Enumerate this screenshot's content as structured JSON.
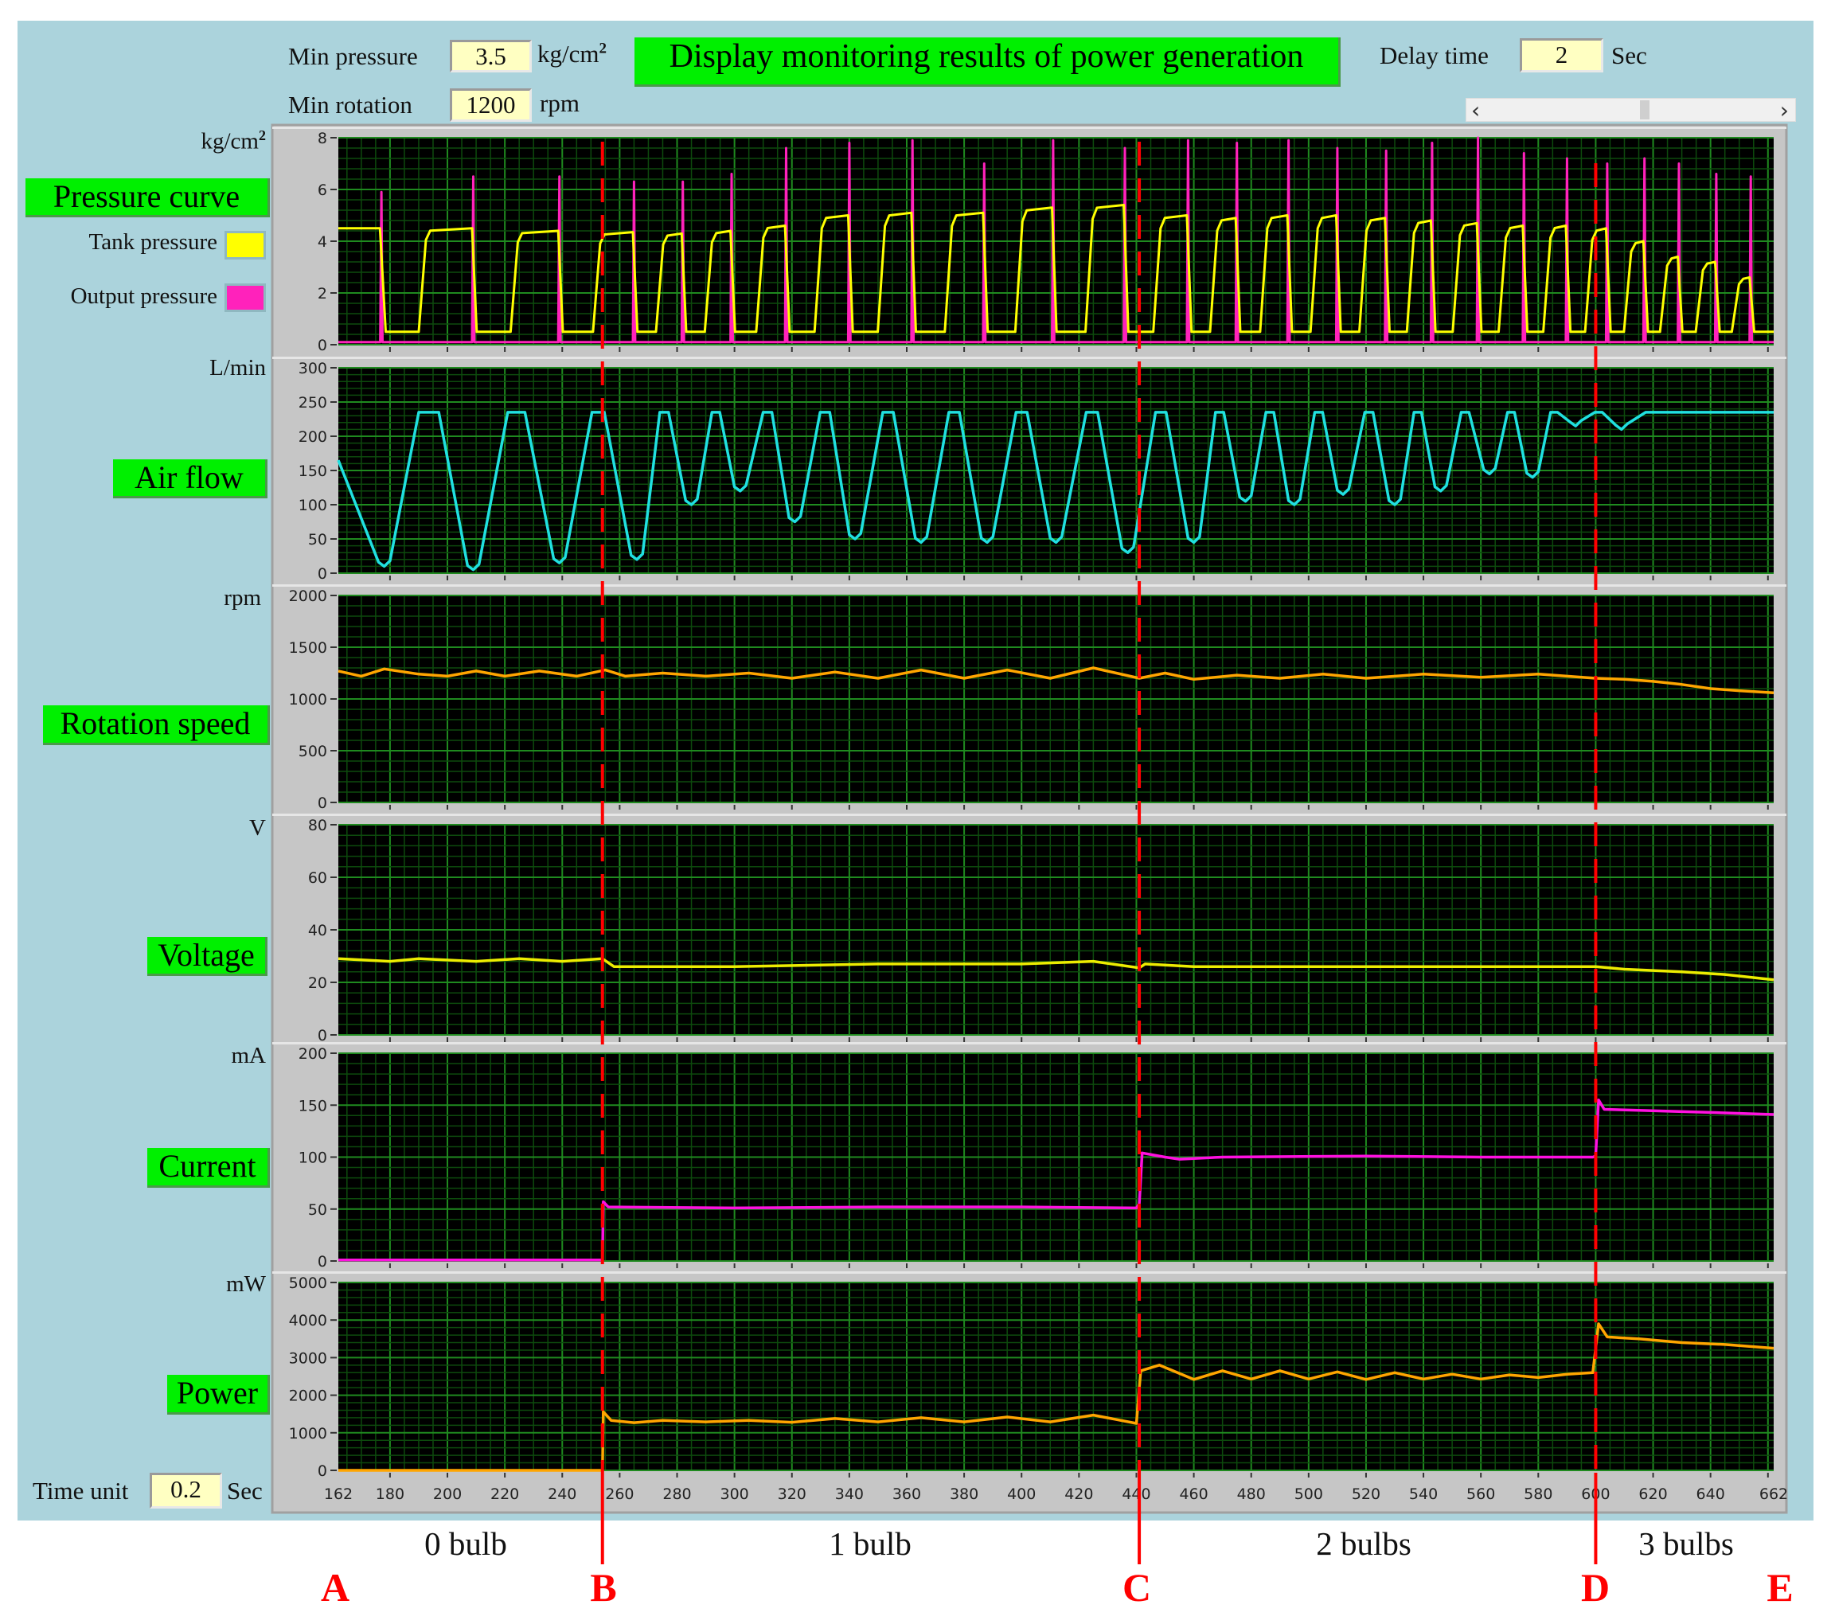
{
  "header": {
    "title": "Display monitoring results of power generation",
    "min_pressure_label": "Min pressure",
    "min_pressure_value": "3.5",
    "min_pressure_unit": "kg/cm",
    "min_pressure_unit_sup": "2",
    "min_rotation_label": "Min rotation",
    "min_rotation_value": "1200",
    "min_rotation_unit": "rpm",
    "delay_time_label": "Delay time",
    "delay_time_value": "2",
    "delay_time_unit": "Sec",
    "scroll_left": "‹",
    "scroll_right": "›"
  },
  "footer": {
    "time_unit_label": "Time unit",
    "time_unit_value": "0.2",
    "time_unit_unit": "Sec"
  },
  "annotations": {
    "stages": [
      "0 bulb",
      "1 bulb",
      "2 bulbs",
      "3 bulbs"
    ],
    "letters": [
      "A",
      "B",
      "C",
      "D",
      "E"
    ],
    "marker_times": [
      254,
      441,
      600
    ]
  },
  "colors": {
    "panel_bg": "#abd3dc",
    "label_green": "#00f000",
    "tank_pressure": "#ffff00",
    "output_pressure": "#ff22bb",
    "air_flow": "#20e0e0",
    "rotation": "#ffa500",
    "voltage": "#ecec00",
    "current": "#ff10e0",
    "power": "#ffa500",
    "marker": "#ff0000"
  },
  "chart_data": [
    {
      "type": "line",
      "title": "Pressure curve",
      "unit": "kg/cm",
      "unit_sup": "2",
      "ylim": [
        0,
        8
      ],
      "yticks": [
        "0",
        "2",
        "4",
        "6",
        "8"
      ],
      "xlim": [
        162,
        662
      ],
      "legend": [
        "Tank pressure",
        "Output pressure"
      ],
      "output_spike_times": [
        177,
        209,
        239,
        265,
        282,
        299,
        318,
        340,
        362,
        387,
        411,
        436,
        458,
        475,
        493,
        510,
        527,
        543,
        559,
        575,
        590,
        604,
        617,
        629,
        642,
        654
      ],
      "output_spike_values": [
        5.9,
        6.5,
        6.5,
        6.3,
        6.3,
        6.6,
        7.6,
        7.8,
        7.9,
        7.0,
        7.9,
        7.6,
        7.9,
        7.8,
        7.9,
        7.6,
        7.5,
        7.8,
        8.0,
        7.4,
        7.2,
        7.0,
        7.2,
        7.0,
        6.6,
        6.5
      ],
      "tank_peak_values": [
        4.5,
        4.5,
        4.4,
        4.35,
        4.3,
        4.4,
        4.6,
        5.0,
        5.1,
        5.1,
        5.3,
        5.4,
        5.0,
        4.9,
        5.0,
        5.0,
        4.9,
        4.8,
        4.7,
        4.6,
        4.6,
        4.5,
        4.0,
        3.4,
        3.2,
        2.6
      ],
      "tank_low_value": 0.5,
      "output_base_value": 0.1
    },
    {
      "type": "line",
      "title": "Air flow",
      "unit": "L/min",
      "ylim": [
        0,
        300
      ],
      "yticks": [
        "0",
        "50",
        "100",
        "150",
        "200",
        "250",
        "300"
      ],
      "xlim": [
        162,
        662
      ],
      "plateau": 235,
      "start_value": 165,
      "troughs": [
        [
          178,
          10
        ],
        [
          209,
          5
        ],
        [
          239,
          15
        ],
        [
          266,
          20
        ],
        [
          285,
          100
        ],
        [
          302,
          120
        ],
        [
          321,
          75
        ],
        [
          342,
          50
        ],
        [
          365,
          45
        ],
        [
          388,
          45
        ],
        [
          412,
          45
        ],
        [
          437,
          30
        ],
        [
          460,
          45
        ],
        [
          478,
          105
        ],
        [
          495,
          100
        ],
        [
          512,
          115
        ],
        [
          530,
          100
        ],
        [
          546,
          120
        ],
        [
          563,
          145
        ],
        [
          578,
          140
        ],
        [
          593,
          215
        ],
        [
          609,
          210
        ]
      ]
    },
    {
      "type": "line",
      "title": "Rotation speed",
      "unit": "rpm",
      "ylim": [
        0,
        2000
      ],
      "yticks": [
        "0",
        "500",
        "1000",
        "1500",
        "2000"
      ],
      "xlim": [
        162,
        662
      ],
      "points": [
        [
          162,
          1270
        ],
        [
          170,
          1220
        ],
        [
          178,
          1290
        ],
        [
          190,
          1240
        ],
        [
          200,
          1220
        ],
        [
          210,
          1270
        ],
        [
          220,
          1220
        ],
        [
          232,
          1270
        ],
        [
          245,
          1220
        ],
        [
          255,
          1280
        ],
        [
          262,
          1220
        ],
        [
          275,
          1250
        ],
        [
          290,
          1220
        ],
        [
          305,
          1250
        ],
        [
          320,
          1200
        ],
        [
          335,
          1260
        ],
        [
          350,
          1200
        ],
        [
          365,
          1280
        ],
        [
          380,
          1200
        ],
        [
          395,
          1280
        ],
        [
          410,
          1200
        ],
        [
          425,
          1300
        ],
        [
          441,
          1200
        ],
        [
          450,
          1250
        ],
        [
          460,
          1190
        ],
        [
          475,
          1230
        ],
        [
          490,
          1200
        ],
        [
          505,
          1240
        ],
        [
          520,
          1200
        ],
        [
          540,
          1240
        ],
        [
          560,
          1210
        ],
        [
          580,
          1240
        ],
        [
          600,
          1200
        ],
        [
          610,
          1190
        ],
        [
          620,
          1170
        ],
        [
          630,
          1140
        ],
        [
          640,
          1100
        ],
        [
          650,
          1080
        ],
        [
          662,
          1060
        ]
      ]
    },
    {
      "type": "line",
      "title": "Voltage",
      "unit": "V",
      "ylim": [
        0,
        80
      ],
      "yticks": [
        "0",
        "20",
        "40",
        "60",
        "80"
      ],
      "xlim": [
        162,
        662
      ],
      "points": [
        [
          162,
          29
        ],
        [
          180,
          28
        ],
        [
          190,
          29
        ],
        [
          210,
          28
        ],
        [
          225,
          29
        ],
        [
          240,
          28
        ],
        [
          254,
          29
        ],
        [
          258,
          26
        ],
        [
          300,
          26
        ],
        [
          350,
          27
        ],
        [
          400,
          27
        ],
        [
          425,
          28
        ],
        [
          441,
          25.5
        ],
        [
          443,
          27
        ],
        [
          460,
          26
        ],
        [
          500,
          26
        ],
        [
          550,
          26
        ],
        [
          600,
          26
        ],
        [
          610,
          25
        ],
        [
          630,
          24
        ],
        [
          645,
          23
        ],
        [
          662,
          21
        ]
      ]
    },
    {
      "type": "line",
      "title": "Current",
      "unit": "mA",
      "ylim": [
        0,
        200
      ],
      "yticks": [
        "0",
        "50",
        "100",
        "150",
        "200"
      ],
      "xlim": [
        162,
        662
      ],
      "points": [
        [
          162,
          1
        ],
        [
          254,
          1
        ],
        [
          254.3,
          57
        ],
        [
          256,
          52
        ],
        [
          300,
          51
        ],
        [
          350,
          52
        ],
        [
          400,
          52
        ],
        [
          440,
          51
        ],
        [
          441,
          55
        ],
        [
          442,
          104
        ],
        [
          450,
          100
        ],
        [
          455,
          98
        ],
        [
          470,
          100
        ],
        [
          520,
          101
        ],
        [
          560,
          100
        ],
        [
          599,
          100
        ],
        [
          600,
          101
        ],
        [
          601,
          155
        ],
        [
          603,
          146
        ],
        [
          615,
          145
        ],
        [
          640,
          143
        ],
        [
          662,
          141
        ]
      ]
    },
    {
      "type": "line",
      "title": "Power",
      "unit": "mW",
      "ylim": [
        0,
        5000
      ],
      "yticks": [
        "0",
        "1000",
        "2000",
        "3000",
        "4000",
        "5000"
      ],
      "xlim": [
        162,
        662
      ],
      "xticks": [
        "162",
        "180",
        "200",
        "220",
        "240",
        "260",
        "280",
        "300",
        "320",
        "340",
        "360",
        "380",
        "400",
        "420",
        "440",
        "460",
        "480",
        "500",
        "520",
        "540",
        "560",
        "580",
        "600",
        "620",
        "640",
        "662"
      ],
      "points": [
        [
          162,
          0
        ],
        [
          254,
          0
        ],
        [
          254.3,
          1560
        ],
        [
          257,
          1330
        ],
        [
          265,
          1270
        ],
        [
          275,
          1330
        ],
        [
          290,
          1290
        ],
        [
          305,
          1330
        ],
        [
          320,
          1280
        ],
        [
          335,
          1380
        ],
        [
          350,
          1290
        ],
        [
          365,
          1400
        ],
        [
          380,
          1290
        ],
        [
          395,
          1420
        ],
        [
          410,
          1290
        ],
        [
          425,
          1470
        ],
        [
          440,
          1250
        ],
        [
          441.5,
          2650
        ],
        [
          448,
          2800
        ],
        [
          460,
          2420
        ],
        [
          470,
          2650
        ],
        [
          480,
          2430
        ],
        [
          490,
          2650
        ],
        [
          500,
          2430
        ],
        [
          510,
          2620
        ],
        [
          520,
          2420
        ],
        [
          530,
          2600
        ],
        [
          540,
          2430
        ],
        [
          550,
          2560
        ],
        [
          560,
          2430
        ],
        [
          570,
          2540
        ],
        [
          580,
          2470
        ],
        [
          590,
          2560
        ],
        [
          599,
          2600
        ],
        [
          601,
          3900
        ],
        [
          604,
          3550
        ],
        [
          615,
          3500
        ],
        [
          630,
          3400
        ],
        [
          645,
          3350
        ],
        [
          662,
          3250
        ]
      ]
    }
  ]
}
